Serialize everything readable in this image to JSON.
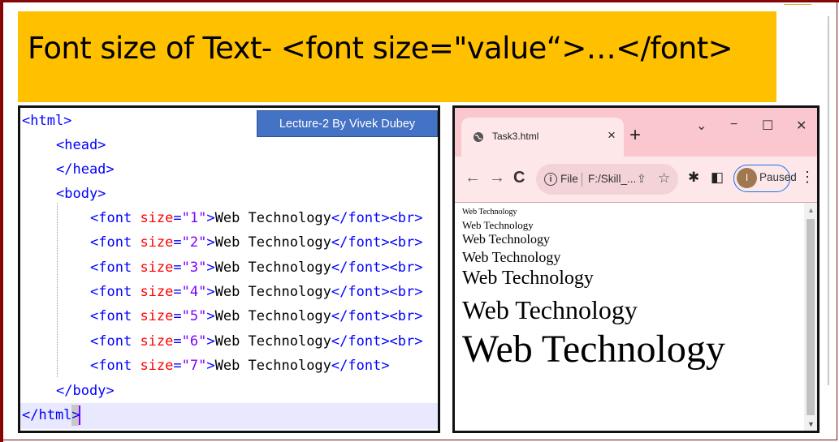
{
  "slide_title": "Font size of Text- <font size=\"value“>…</font>",
  "badge": "Lecture-2 By Vivek Dubey",
  "code": {
    "html_open": "<html>",
    "head_open": "<head>",
    "head_close": "</head>",
    "body_open": "<body>",
    "font_open": "<font",
    "size_attr": "size",
    "equals": "=",
    "font_lines": [
      {
        "value": "\"1\"",
        "close": ">",
        "text": "Web Technology",
        "end": "</font><br>"
      },
      {
        "value": "\"2\"",
        "close": ">",
        "text": "Web Technology",
        "end": "</font><br>"
      },
      {
        "value": "\"3\"",
        "close": ">",
        "text": "Web Technology",
        "end": "</font><br>"
      },
      {
        "value": "\"4\"",
        "close": ">",
        "text": "Web Technology",
        "end": "</font><br>"
      },
      {
        "value": "\"5\"",
        "close": ">",
        "text": "Web Technology",
        "end": "</font><br>"
      },
      {
        "value": "\"6\"",
        "close": ">",
        "text": "Web Technology",
        "end": "</font><br>"
      },
      {
        "value": "\"7\"",
        "close": ">",
        "text": "Web Technology",
        "end": "</font>"
      }
    ],
    "body_close": "</body>",
    "html_close": "</html",
    "html_close_last": ">"
  },
  "browser": {
    "tab_title": "Task3.html",
    "tab_close": "×",
    "new_tab": "+",
    "win_collapse": "⌄",
    "win_minimize": "−",
    "win_maximize": "☐",
    "win_close": "✕",
    "back": "←",
    "forward": "→",
    "reload": "C",
    "info": "i",
    "scheme": "File",
    "url": "F:/Skill_...",
    "profile_initial": "I",
    "profile_status": "Paused",
    "menu": "⋮",
    "rendered_lines": [
      "Web Technology",
      "Web Technology",
      "Web Technology",
      "Web Technology",
      "Web Technology",
      "Web Technology",
      "Web Technology"
    ],
    "font_sizes": [
      1,
      2,
      3,
      4,
      5,
      6,
      7
    ]
  },
  "colors": {
    "title_band": "#ffc000",
    "badge": "#4472c4",
    "tag": "#0000ff",
    "attribute": "#ff0000",
    "value": "#8000ff",
    "browser_tabstrip": "#f9c7cd"
  }
}
